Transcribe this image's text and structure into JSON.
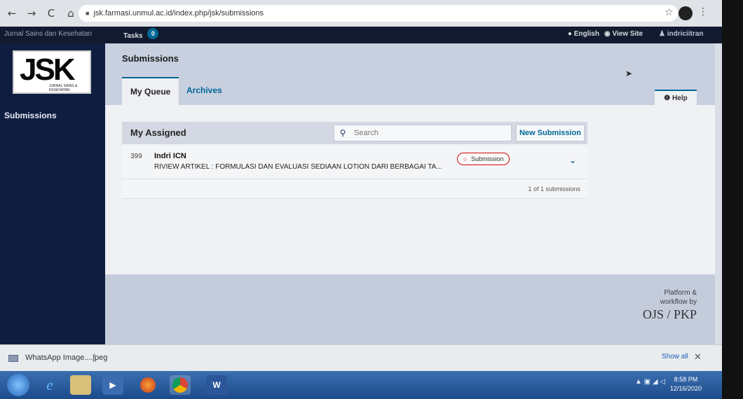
{
  "browser": {
    "back": "←",
    "forward": "→",
    "reload": "C",
    "home": "⌂",
    "url": "jsk.farmasi.unmul.ac.id/index.php/jsk/submissions"
  },
  "topbar": {
    "site_name": "Jurnal Sains dan Kesehatan",
    "tasks_label": "Tasks",
    "tasks_count": "0",
    "language": "English",
    "view_site": "View Site",
    "username": "indriciitran"
  },
  "sidebar": {
    "logo_text": "JSK",
    "logo_subtitle": "JURNAL SAINS & KESEHATAN",
    "items": [
      {
        "label": "Submissions"
      }
    ]
  },
  "header": {
    "title": "Submissions",
    "tabs": [
      {
        "label": "My Queue"
      },
      {
        "label": "Archives"
      }
    ],
    "help_label": "Help"
  },
  "queue": {
    "panel_title": "My Assigned",
    "search_placeholder": "Search",
    "new_submission_label": "New Submission",
    "rows": [
      {
        "id": "399",
        "author": "Indri ICN",
        "title": "RIVIEW ARTIKEL : FORMULASI DAN EVALUASI SEDIAAN LOTION DARI BERBAGAI TA...",
        "stage": "Submission"
      }
    ],
    "count_text": "1 of 1 submissions"
  },
  "footer": {
    "line1": "Platform &",
    "line2": "workflow by",
    "brand": "OJS / PKP"
  },
  "downloads": {
    "file_name": "WhatsApp Image....jpeg",
    "show_all": "Show all",
    "close": "✕"
  },
  "taskbar": {
    "time": "8:58 PM",
    "date": "12/16/2020"
  },
  "colors": {
    "accent": "#006798",
    "sidebar": "#0f1e40",
    "badge_border": "#d00a0a"
  }
}
